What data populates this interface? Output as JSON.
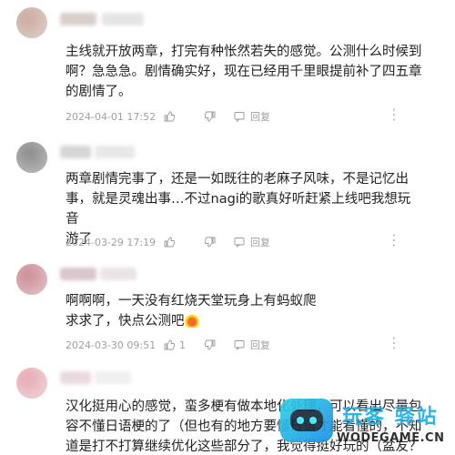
{
  "comments": [
    {
      "text": "主线就开放两章，打完有种怅然若失的感觉。公测什么时候到\n啊？急急急。剧情确实好，现在已经用千里眼提前补了四五章\n的剧情了。",
      "timestamp": "2024-04-01 17:52",
      "likes": "",
      "reply_label": "回复",
      "avatar_color": "#c9a9a0",
      "avatar_color2": "#e8ddd8"
    },
    {
      "text": "两章剧情完事了，还是一如既往的老麻子风味，不是记忆出\n事，就是灵魂出事…不过nagi的歌真好听赶紧上线吧我想玩音\n游了",
      "timestamp": "2024-03-29 17:19",
      "likes": "",
      "reply_label": "回复",
      "avatar_color": "#8a8a8a",
      "avatar_color2": "#cfcfcf"
    },
    {
      "text": "啊啊啊，一天没有红烧天堂玩身上有蚂蚁爬\n求求了，快点公测吧",
      "timestamp": "2024-03-30 09:51",
      "likes": "1",
      "reply_label": "回复",
      "avatar_color": "#c98b95",
      "avatar_color2": "#efd6da"
    },
    {
      "text": "汉化挺用心的感觉，蛮多梗有做本地化处理，可以看出尽量包\n容不懂日语梗的了（但也有的地方要懂日语才能看懂的，不知\n道是打不打算继续优化这些部分了，我觉得挺好玩的（盆友？",
      "timestamp": "",
      "likes": "",
      "reply_label": "",
      "avatar_color": "#e6a8b4",
      "avatar_color2": "#f6e4e8"
    }
  ],
  "watermark": {
    "title": "玩客 驿站",
    "subtitle": "WODEGAME.CN"
  },
  "colors": {
    "text": "#222222",
    "meta": "#a0a0a0",
    "accent": "#1ab1e8"
  },
  "icons": {
    "like": "thumbs-up-icon",
    "dislike": "thumbs-down-icon",
    "reply": "reply-icon",
    "menu": "more-vertical-icon"
  }
}
